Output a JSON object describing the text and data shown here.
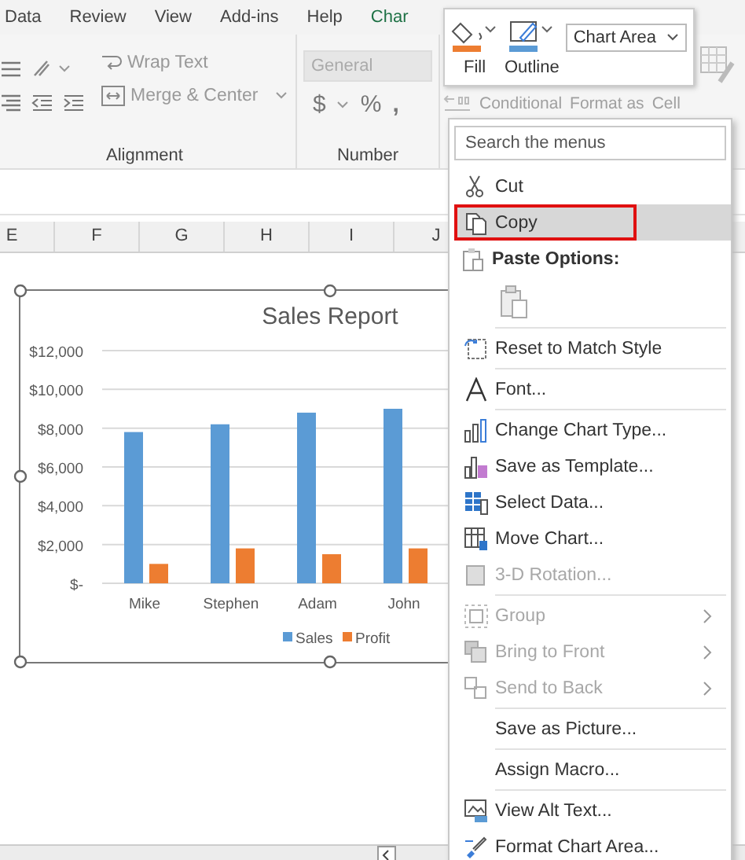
{
  "ribbon_tabs": [
    {
      "label": "Data",
      "kind": "normal"
    },
    {
      "label": "Review",
      "kind": "normal"
    },
    {
      "label": "View",
      "kind": "normal"
    },
    {
      "label": "Add-ins",
      "kind": "normal"
    },
    {
      "label": "Help",
      "kind": "normal"
    },
    {
      "label": "Char",
      "kind": "contextual"
    }
  ],
  "ribbon": {
    "wrap_text": "Wrap Text",
    "merge_center": "Merge & Center",
    "number_format": {
      "value": "General"
    },
    "currency": "$",
    "percent": "%",
    "comma": ",",
    "group_labels": [
      "Alignment",
      "Number"
    ],
    "styles_labels": [
      "Conditional",
      "Format as",
      "Cell"
    ]
  },
  "column_headers": [
    "E",
    "F",
    "G",
    "H",
    "I",
    "J"
  ],
  "chart": {
    "chart_data": {
      "type": "bar",
      "title": "Sales Report",
      "categories": [
        "Mike",
        "Stephen",
        "Adam",
        "John"
      ],
      "series": [
        {
          "name": "Sales",
          "color": "#5b9bd5",
          "values": [
            7800,
            8200,
            8800,
            9000
          ]
        },
        {
          "name": "Profit",
          "color": "#ed7d31",
          "values": [
            1000,
            1800,
            1500,
            1800
          ]
        }
      ],
      "grid": true,
      "legend": true,
      "ylim": [
        0,
        12000
      ],
      "yticks": [
        {
          "value": 0,
          "label": "$-"
        },
        {
          "value": 2000,
          "label": "$2,000"
        },
        {
          "value": 4000,
          "label": "$4,000"
        },
        {
          "value": 6000,
          "label": "$6,000"
        },
        {
          "value": 8000,
          "label": "$8,000"
        },
        {
          "value": 10000,
          "label": "$10,000"
        },
        {
          "value": 12000,
          "label": "$12,000"
        }
      ]
    }
  },
  "mini_toolbar": {
    "fill": "Fill",
    "outline": "Outline",
    "element_dropdown": {
      "value": "Chart Area"
    }
  },
  "context_menu": {
    "search": {
      "placeholder": "Search the menus"
    },
    "items": [
      {
        "kind": "item",
        "label": "Cut",
        "selected": false,
        "disabled": false,
        "submenu": false
      },
      {
        "kind": "item",
        "label": "Copy",
        "selected": true,
        "disabled": false,
        "submenu": false
      },
      {
        "kind": "heading",
        "label": "Paste Options:"
      },
      {
        "kind": "paste_icons"
      },
      {
        "kind": "separator"
      },
      {
        "kind": "item",
        "label": "Reset to Match Style",
        "selected": false,
        "disabled": false,
        "submenu": false
      },
      {
        "kind": "separator"
      },
      {
        "kind": "item",
        "label": "Font...",
        "selected": false,
        "disabled": false,
        "submenu": false
      },
      {
        "kind": "separator"
      },
      {
        "kind": "item",
        "label": "Change Chart Type...",
        "selected": false,
        "disabled": false,
        "submenu": false
      },
      {
        "kind": "item",
        "label": "Save as Template...",
        "selected": false,
        "disabled": false,
        "submenu": false
      },
      {
        "kind": "item",
        "label": "Select Data...",
        "selected": false,
        "disabled": false,
        "submenu": false
      },
      {
        "kind": "item",
        "label": "Move Chart...",
        "selected": false,
        "disabled": false,
        "submenu": false
      },
      {
        "kind": "item",
        "label": "3-D Rotation...",
        "selected": false,
        "disabled": true,
        "submenu": false
      },
      {
        "kind": "separator"
      },
      {
        "kind": "item",
        "label": "Group",
        "selected": false,
        "disabled": true,
        "submenu": true
      },
      {
        "kind": "item",
        "label": "Bring to Front",
        "selected": false,
        "disabled": true,
        "submenu": true
      },
      {
        "kind": "item",
        "label": "Send to Back",
        "selected": false,
        "disabled": true,
        "submenu": true
      },
      {
        "kind": "separator"
      },
      {
        "kind": "item",
        "label": "Save as Picture...",
        "selected": false,
        "disabled": false,
        "submenu": false
      },
      {
        "kind": "separator"
      },
      {
        "kind": "item",
        "label": "Assign Macro...",
        "selected": false,
        "disabled": false,
        "submenu": false
      },
      {
        "kind": "separator"
      },
      {
        "kind": "item",
        "label": "View Alt Text...",
        "selected": false,
        "disabled": false,
        "submenu": false
      },
      {
        "kind": "item",
        "label": "Format Chart Area...",
        "selected": false,
        "disabled": false,
        "submenu": false
      }
    ]
  }
}
